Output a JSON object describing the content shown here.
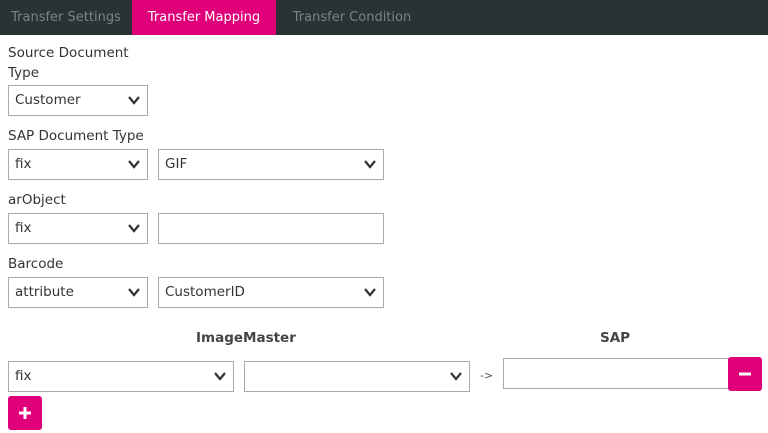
{
  "tabs": [
    {
      "label": "Transfer Settings",
      "active": false
    },
    {
      "label": "Transfer Mapping",
      "active": true
    },
    {
      "label": "Transfer Condition",
      "active": false
    }
  ],
  "source_document_type": {
    "label_line1": "Source Document",
    "label_line2": "Type",
    "value": "Customer"
  },
  "sap_document_type": {
    "label": "SAP Document Type",
    "mode": "fix",
    "value": "GIF"
  },
  "ar_object": {
    "label": "arObject",
    "mode": "fix",
    "value": ""
  },
  "barcode": {
    "label": "Barcode",
    "mode": "attribute",
    "value": "CustomerID"
  },
  "mapping": {
    "imagemaster_header": "ImageMaster",
    "sap_header": "SAP",
    "rows": [
      {
        "mode": "fix",
        "field": "",
        "arrow": "->",
        "sap_value": ""
      }
    ]
  },
  "colors": {
    "accent": "#e0007a",
    "tabbar": "#2b3236"
  },
  "icons": {
    "remove": "minus-icon",
    "add": "plus-icon",
    "dropdown": "chevron-down-icon"
  }
}
